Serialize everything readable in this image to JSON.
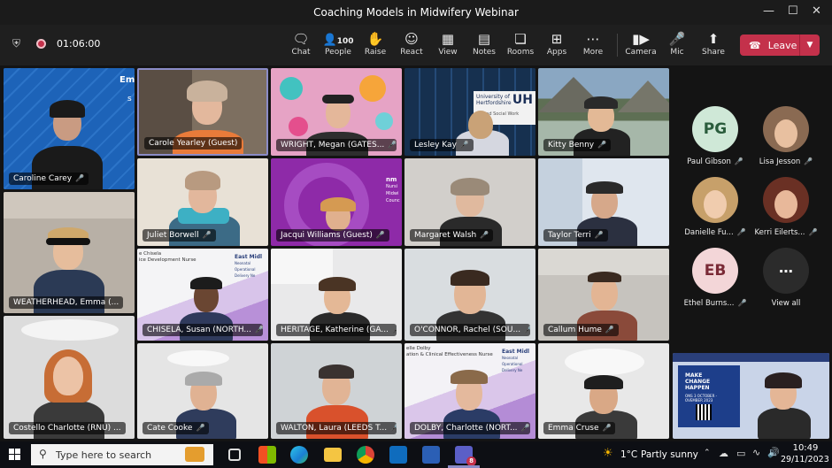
{
  "window": {
    "title": "Coaching Models in Midwifery Webinar"
  },
  "toolbar": {
    "timer": "01:06:00",
    "people_count": "100",
    "buttons": [
      {
        "label": "Chat",
        "icon": "chat-icon"
      },
      {
        "label": "People",
        "icon": "people-icon"
      },
      {
        "label": "Raise",
        "icon": "raise-hand-icon"
      },
      {
        "label": "React",
        "icon": "react-icon"
      },
      {
        "label": "View",
        "icon": "view-icon"
      },
      {
        "label": "Notes",
        "icon": "notes-icon"
      },
      {
        "label": "Rooms",
        "icon": "rooms-icon"
      },
      {
        "label": "Apps",
        "icon": "apps-icon"
      },
      {
        "label": "More",
        "icon": "more-icon"
      },
      {
        "label": "Camera",
        "icon": "camera-icon"
      },
      {
        "label": "Mic",
        "icon": "mic-off-icon"
      },
      {
        "label": "Share",
        "icon": "share-icon"
      }
    ],
    "leave_label": "Leave"
  },
  "participants": [
    {
      "name": "Caroline Carey"
    },
    {
      "name": "Carole Yearley (Guest)"
    },
    {
      "name": "WRIGHT, Megan (GATES..."
    },
    {
      "name": "Lesley Kay"
    },
    {
      "name": "Kitty Benny"
    },
    {
      "name": "WEATHERHEAD, Emma (..."
    },
    {
      "name": "Juliet Borwell"
    },
    {
      "name": "Jacqui Williams (Guest)"
    },
    {
      "name": "Margaret Walsh"
    },
    {
      "name": "Taylor Terri"
    },
    {
      "name": "Costello Charlotte (RNU) ..."
    },
    {
      "name": "CHISELA, Susan (NORTH..."
    },
    {
      "name": "HERITAGE, Katherine (GA..."
    },
    {
      "name": "O'CONNOR, Rachel (SOU..."
    },
    {
      "name": "Callum Hume"
    },
    {
      "name": "Cate Cooke"
    },
    {
      "name": "WALTON, Laura (LEEDS T..."
    },
    {
      "name": "DOLBY, Charlotte (NORT..."
    },
    {
      "name": "Emma Cruse"
    }
  ],
  "slides": {
    "uh": "University of Hertfordshire",
    "uh_short": "UH",
    "uh_sub": "lth and Social Work",
    "em": "East Midl",
    "em_sub": "Neonatal Operational Delivery Ne",
    "chisela_slide": "e Chisela",
    "chisela_sub": "ice Development Nurse",
    "dolby_slide": "elle Dolby",
    "dolby_sub": "ation & Clinical Effectiveness Nurse",
    "nmc": "Nursi Midwi Counc",
    "nmc_short": "nm",
    "banner_em": "Em",
    "banner_s": "s"
  },
  "roster": [
    {
      "name": "Paul Gibson",
      "initials": "PG"
    },
    {
      "name": "Lisa Jesson"
    },
    {
      "name": "Danielle Fu..."
    },
    {
      "name": "Kerri Eilerts..."
    },
    {
      "name": "Ethel Burns...",
      "initials": "EB"
    },
    {
      "name": "View all"
    }
  ],
  "shared_screen": {
    "line1": "MAKE",
    "line2": "CHANGE",
    "line3": "HAPPEN",
    "date_line": "OVEMBER 2023",
    "date_line2": "ONS 3 OCTOBER -"
  },
  "taskbar": {
    "search_placeholder": "Type here to search",
    "weather_temp": "1°C",
    "weather_text": "Partly sunny",
    "time": "10:49",
    "date": "29/11/2023",
    "teams_badge": "8"
  },
  "colors": {
    "leave": "#c4314b",
    "accent_speaker": "#8b8cc7"
  }
}
